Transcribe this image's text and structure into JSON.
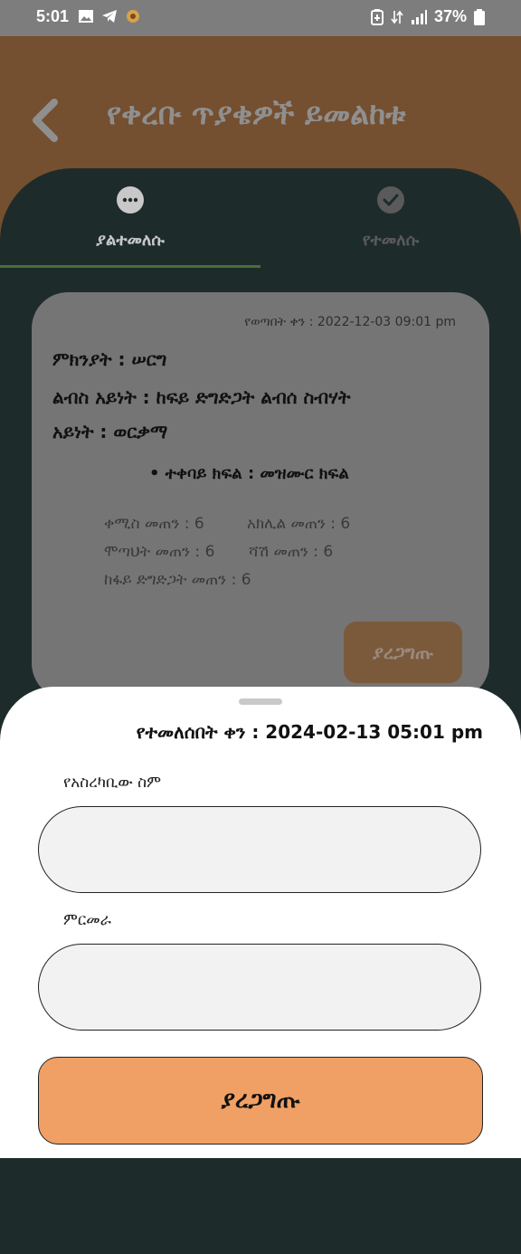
{
  "status_bar": {
    "time": "5:01",
    "battery": "37%"
  },
  "header": {
    "title": "የቀረቡ ጥያቄዎች ይመልከቱ"
  },
  "tabs": [
    {
      "label": "ያልተመለሱ",
      "icon": "more-horizontal-icon",
      "active": true
    },
    {
      "label": "የተመለሱ",
      "icon": "check-circle-icon",
      "active": false
    }
  ],
  "card": {
    "date": "የወጣበት ቀን : 2022-12-03 09:01 pm",
    "reason": "ምክንያት : ሠርግ",
    "cloth_type": "ልብስ አይነት : ከፍይ ድግድጋት ልብሰ ስብሃት",
    "type": "አይነት : ወርቃማ",
    "receiver": "• ተቀባይ ክፍል : መዝሙር ክፍል",
    "quantities": [
      "ቀሚስ መጠን : 6",
      "አክሊል መጠን : 6",
      "ሞጣህት መጠን : 6",
      "ሻሽ መጠን : 6",
      "ከፋይ ድግድጋት መጠን : 6"
    ],
    "confirm_label": "ያረጋግጡ"
  },
  "sheet": {
    "return_date": "የተመለሰበት ቀን : 2024-02-13 05:01 pm",
    "name_label": "የአስረካቢው ስም",
    "name_value": "",
    "comment_label": "ምርመራ",
    "comment_value": "",
    "confirm_label": "ያረጋግጡ"
  },
  "colors": {
    "header_bg": "#744f30",
    "panel_bg": "#1e2b2b",
    "card_bg": "#757575",
    "confirm_button": "#f0a064",
    "tab_indicator": "#4a6d3a"
  }
}
